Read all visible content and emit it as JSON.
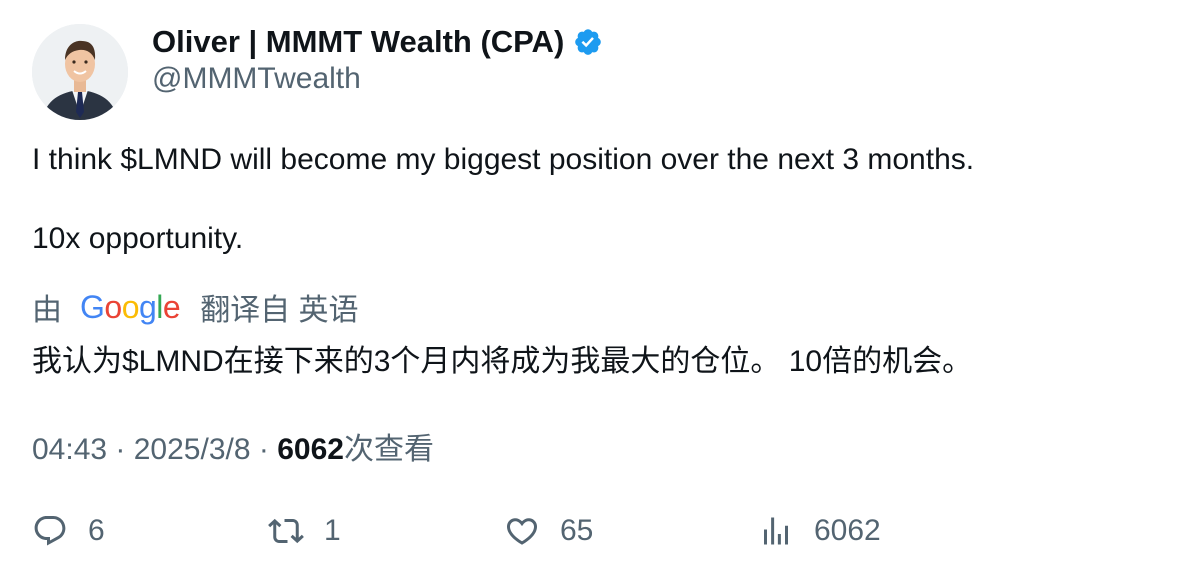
{
  "author": {
    "display_name": "Oliver | MMMT Wealth (CPA)",
    "handle": "@MMMTwealth",
    "verified_icon": "verified-badge-icon",
    "avatar_icon": "profile-photo"
  },
  "tweet": {
    "line1": "I think $LMND will become my biggest position over the next 3 months.",
    "line2": "10x opportunity."
  },
  "translation": {
    "prefix": "由",
    "provider": "Google",
    "suffix": "翻译自 英语",
    "text": "我认为$LMND在接下来的3个月内将成为我最大的仓位。 10倍的机会。"
  },
  "meta": {
    "time": "04:43",
    "separator1": " · ",
    "date": "2025/3/8",
    "separator2": " · ",
    "views_count": "6062",
    "views_label": "次查看"
  },
  "actions": {
    "reply_count": "6",
    "retweet_count": "1",
    "like_count": "65",
    "views_count": "6062"
  },
  "colors": {
    "text_primary": "#0f1419",
    "text_secondary": "#536471",
    "verified_blue": "#1d9bf0"
  }
}
